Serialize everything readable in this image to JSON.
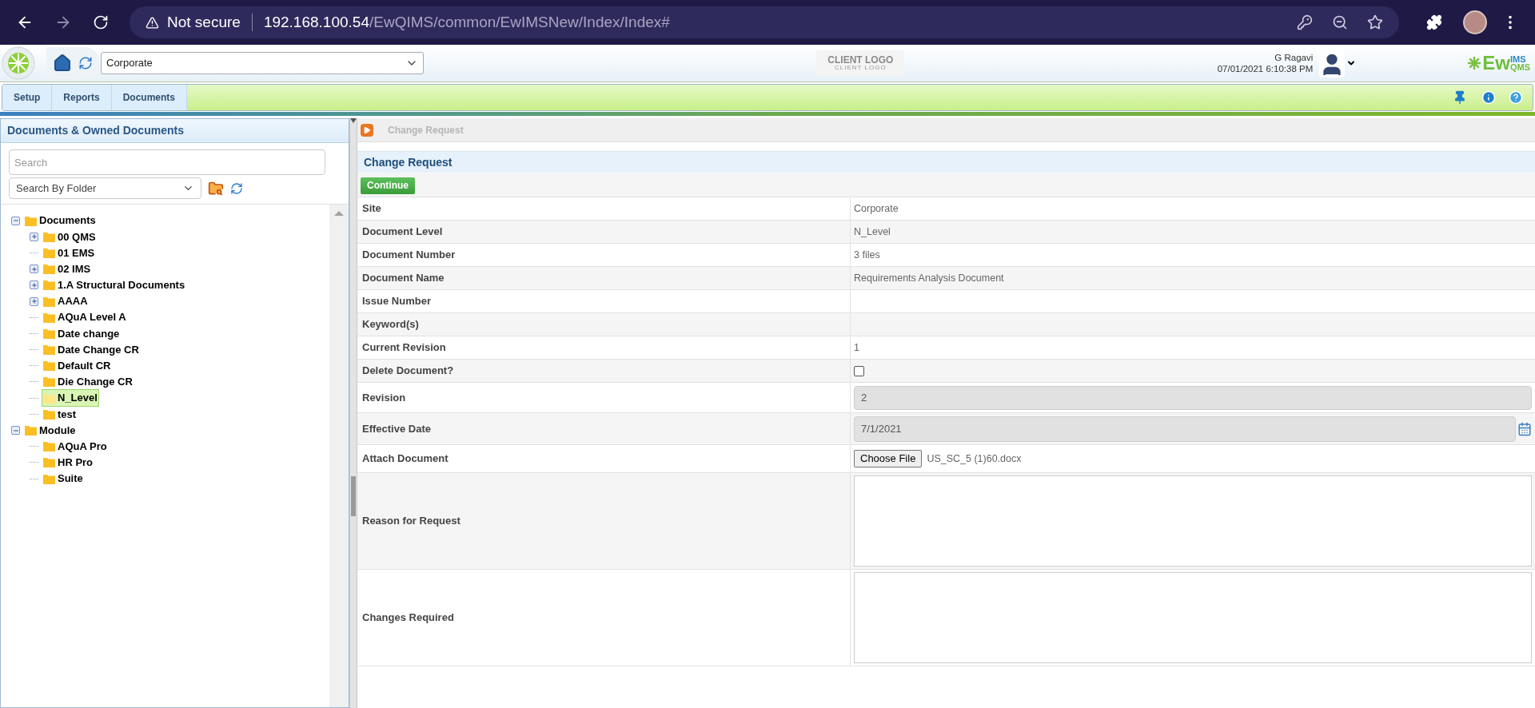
{
  "browser": {
    "security": "Not secure",
    "host": "192.168.100.54",
    "path": "/EwQIMS/common/EwIMSNew/Index/Index#"
  },
  "header": {
    "site_select": "Corporate",
    "client_logo": "CLIENT LOGO",
    "client_logo_sub": "CLIENT LOGO",
    "user_name": "G Ragavi",
    "datetime": "07/01/2021 6:10:38 PM",
    "brand_main": "Ew",
    "brand_top": "IMS",
    "brand_bottom": "QMS"
  },
  "menu": [
    "Setup",
    "Reports",
    "Documents"
  ],
  "sidebar": {
    "title": "Documents & Owned Documents",
    "search": {
      "placeholder": "Search"
    },
    "folder_select": "Search By Folder",
    "tree": [
      {
        "label": "Documents",
        "kind": "open",
        "selected": false,
        "children": [
          {
            "label": "00 QMS",
            "kind": "closed",
            "selected": false
          },
          {
            "label": "01 EMS",
            "kind": "leaf",
            "selected": false
          },
          {
            "label": "02 IMS",
            "kind": "closed",
            "selected": false
          },
          {
            "label": "1.A Structural Documents",
            "kind": "closed",
            "selected": false
          },
          {
            "label": "AAAA",
            "kind": "closed",
            "selected": false
          },
          {
            "label": "AQuA Level A",
            "kind": "leaf",
            "selected": false
          },
          {
            "label": "Date change",
            "kind": "leaf",
            "selected": false
          },
          {
            "label": "Date Change CR",
            "kind": "leaf",
            "selected": false
          },
          {
            "label": "Default CR",
            "kind": "leaf",
            "selected": false
          },
          {
            "label": "Die Change CR",
            "kind": "leaf",
            "selected": false
          },
          {
            "label": "N_Level",
            "kind": "leaf",
            "selected": true
          },
          {
            "label": "test",
            "kind": "leaf",
            "selected": false
          }
        ]
      },
      {
        "label": "Module",
        "kind": "open",
        "selected": false,
        "children": [
          {
            "label": "AQuA Pro",
            "kind": "leaf",
            "selected": false
          },
          {
            "label": "HR Pro",
            "kind": "leaf",
            "selected": false
          },
          {
            "label": "Suite",
            "kind": "leaf",
            "selected": false
          }
        ]
      }
    ]
  },
  "breadcrumb": "Change Request",
  "form": {
    "title": "Change Request",
    "button": "Continue",
    "rows": [
      {
        "kind": "text",
        "label": "Site",
        "value": "Corporate"
      },
      {
        "kind": "text",
        "label": "Document Level",
        "value": "N_Level"
      },
      {
        "kind": "text",
        "label": "Document Number",
        "value": "3 files"
      },
      {
        "kind": "text",
        "label": "Document Name",
        "value": "Requirements Analysis Document"
      },
      {
        "kind": "text",
        "label": "Issue Number"
      },
      {
        "kind": "text",
        "label": "Keyword(s)"
      },
      {
        "kind": "text",
        "label": "Current Revision",
        "value": "1"
      },
      {
        "kind": "checkbox",
        "label": "Delete Document?",
        "checked": false
      },
      {
        "kind": "input",
        "label": "Revision",
        "value": "2"
      },
      {
        "kind": "date",
        "label": "Effective Date",
        "value": "7/1/2021"
      },
      {
        "kind": "file",
        "label": "Attach Document",
        "button": "Choose File",
        "value": "US_SC_5 (1)60.docx"
      },
      {
        "kind": "textarea",
        "label": "Reason for Request"
      },
      {
        "kind": "textarea",
        "label": "Changes Required"
      }
    ]
  }
}
